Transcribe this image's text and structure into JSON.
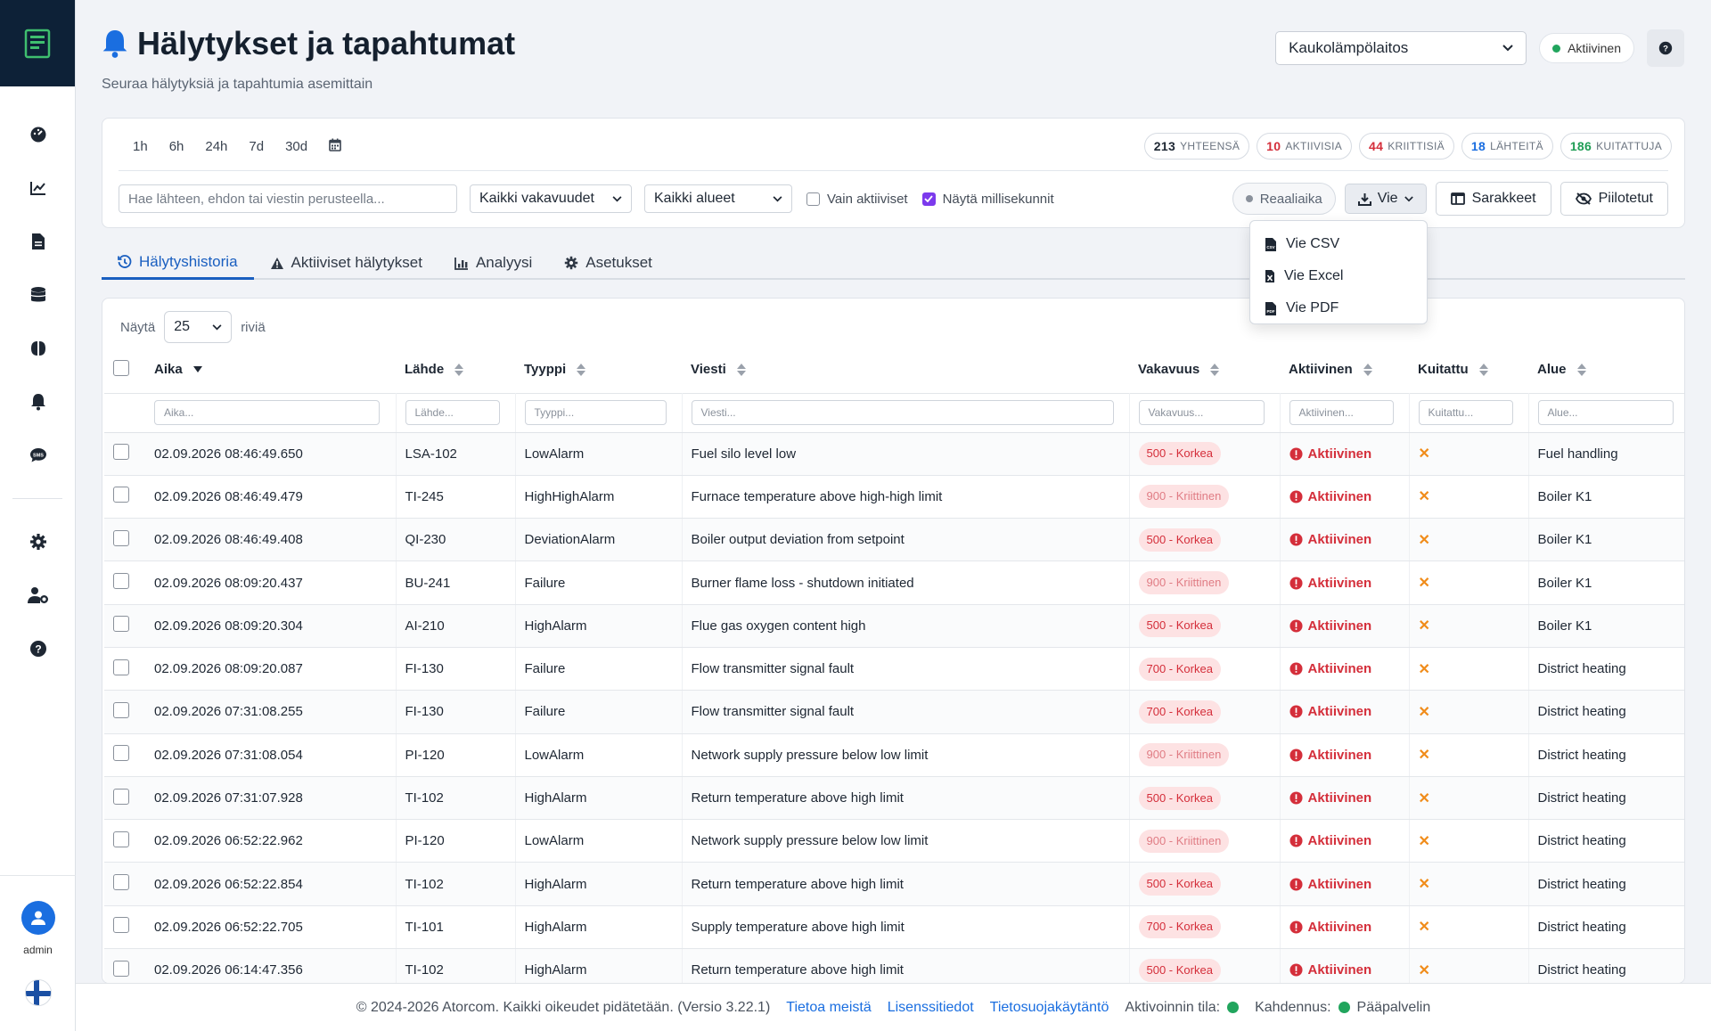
{
  "header": {
    "title": "Hälytykset ja tapahtumat",
    "subtitle": "Seuraa hälytyksiä ja tapahtumia asemittain",
    "plant_selected": "Kaukolämpölaitos",
    "status": "Aktiivinen"
  },
  "sidebar": {
    "items": [
      "dashboard-icon",
      "chart-line-icon",
      "file-icon",
      "database-icon",
      "brain-icon",
      "bell-icon",
      "sms-icon",
      "gear-icon",
      "user-gear-icon",
      "question-icon"
    ],
    "username": "admin"
  },
  "filters": {
    "time_ranges": [
      "1h",
      "6h",
      "24h",
      "7d",
      "30d"
    ],
    "counts": [
      {
        "value": "213",
        "label": "YHTEENSÄ",
        "color": "#1e2733"
      },
      {
        "value": "10",
        "label": "AKTIIVISIA",
        "color": "#d42e3a"
      },
      {
        "value": "44",
        "label": "KRIITTISIÄ",
        "color": "#d42e3a"
      },
      {
        "value": "18",
        "label": "LÄHTEITÄ",
        "color": "#1a6ee0"
      },
      {
        "value": "186",
        "label": "KUITATTUJA",
        "color": "#1f9d55"
      }
    ],
    "search_placeholder": "Hae lähteen, ehdon tai viestin perusteella...",
    "severity_select": "Kaikki vakavuudet",
    "area_select": "Kaikki alueet",
    "only_active_label": "Vain aktiiviset",
    "show_ms_label": "Näytä millisekunnit",
    "realtime_label": "Reaaliaika",
    "export_label": "Vie",
    "columns_label": "Sarakkeet",
    "hidden_label": "Piilotetut"
  },
  "export_menu": [
    "Vie CSV",
    "Vie Excel",
    "Vie PDF"
  ],
  "tabs": [
    "Hälytyshistoria",
    "Aktiiviset hälytykset",
    "Analyysi",
    "Asetukset"
  ],
  "table": {
    "show_label": "Näytä",
    "page_size": "25",
    "rows_label": "riviä",
    "columns": [
      "Aika",
      "Lähde",
      "Tyyppi",
      "Viesti",
      "Vakavuus",
      "Aktiivinen",
      "Kuitattu",
      "Alue"
    ],
    "column_filters": [
      "Aika...",
      "Lähde...",
      "Tyyppi...",
      "Viesti...",
      "Vakavuus...",
      "Aktiivinen...",
      "Kuitattu...",
      "Alue..."
    ],
    "active_text": "Aktiivinen",
    "ack_mark": "✕",
    "rows": [
      {
        "time": "02.09.2026 08:46:49.650",
        "source": "LSA-102",
        "type": "LowAlarm",
        "message": "Fuel silo level low",
        "severity": "500 - Korkea",
        "sev": "h",
        "area": "Fuel handling"
      },
      {
        "time": "02.09.2026 08:46:49.479",
        "source": "TI-245",
        "type": "HighHighAlarm",
        "message": "Furnace temperature above high-high limit",
        "severity": "900 - Kriittinen",
        "sev": "k",
        "area": "Boiler K1"
      },
      {
        "time": "02.09.2026 08:46:49.408",
        "source": "QI-230",
        "type": "DeviationAlarm",
        "message": "Boiler output deviation from setpoint",
        "severity": "500 - Korkea",
        "sev": "h",
        "area": "Boiler K1"
      },
      {
        "time": "02.09.2026 08:09:20.437",
        "source": "BU-241",
        "type": "Failure",
        "message": "Burner flame loss - shutdown initiated",
        "severity": "900 - Kriittinen",
        "sev": "k",
        "area": "Boiler K1"
      },
      {
        "time": "02.09.2026 08:09:20.304",
        "source": "AI-210",
        "type": "HighAlarm",
        "message": "Flue gas oxygen content high",
        "severity": "500 - Korkea",
        "sev": "h",
        "area": "Boiler K1"
      },
      {
        "time": "02.09.2026 08:09:20.087",
        "source": "FI-130",
        "type": "Failure",
        "message": "Flow transmitter signal fault",
        "severity": "700 - Korkea",
        "sev": "h",
        "area": "District heating"
      },
      {
        "time": "02.09.2026 07:31:08.255",
        "source": "FI-130",
        "type": "Failure",
        "message": "Flow transmitter signal fault",
        "severity": "700 - Korkea",
        "sev": "h",
        "area": "District heating"
      },
      {
        "time": "02.09.2026 07:31:08.054",
        "source": "PI-120",
        "type": "LowAlarm",
        "message": "Network supply pressure below low limit",
        "severity": "900 - Kriittinen",
        "sev": "k",
        "area": "District heating"
      },
      {
        "time": "02.09.2026 07:31:07.928",
        "source": "TI-102",
        "type": "HighAlarm",
        "message": "Return temperature above high limit",
        "severity": "500 - Korkea",
        "sev": "h",
        "area": "District heating"
      },
      {
        "time": "02.09.2026 06:52:22.962",
        "source": "PI-120",
        "type": "LowAlarm",
        "message": "Network supply pressure below low limit",
        "severity": "900 - Kriittinen",
        "sev": "k",
        "area": "District heating"
      },
      {
        "time": "02.09.2026 06:52:22.854",
        "source": "TI-102",
        "type": "HighAlarm",
        "message": "Return temperature above high limit",
        "severity": "500 - Korkea",
        "sev": "h",
        "area": "District heating"
      },
      {
        "time": "02.09.2026 06:52:22.705",
        "source": "TI-101",
        "type": "HighAlarm",
        "message": "Supply temperature above high limit",
        "severity": "700 - Korkea",
        "sev": "h",
        "area": "District heating"
      },
      {
        "time": "02.09.2026 06:14:47.356",
        "source": "TI-102",
        "type": "HighAlarm",
        "message": "Return temperature above high limit",
        "severity": "500 - Korkea",
        "sev": "h",
        "area": "District heating"
      }
    ]
  },
  "footer": {
    "copyright": "© 2024-2026 Atorcom. Kaikki oikeudet pidätetään. (Versio 3.22.1)",
    "links": [
      "Tietoa meistä",
      "Lisenssitiedot",
      "Tietosuojakäytäntö"
    ],
    "activation_label": "Aktivoinnin tila:",
    "redundancy_label": "Kahdennus:",
    "redundancy_value": "Pääpalvelin"
  },
  "colors": {
    "accent": "#1a5fc0",
    "danger": "#d42e3a",
    "ok": "#21a55d",
    "warning": "#f08c1a"
  }
}
